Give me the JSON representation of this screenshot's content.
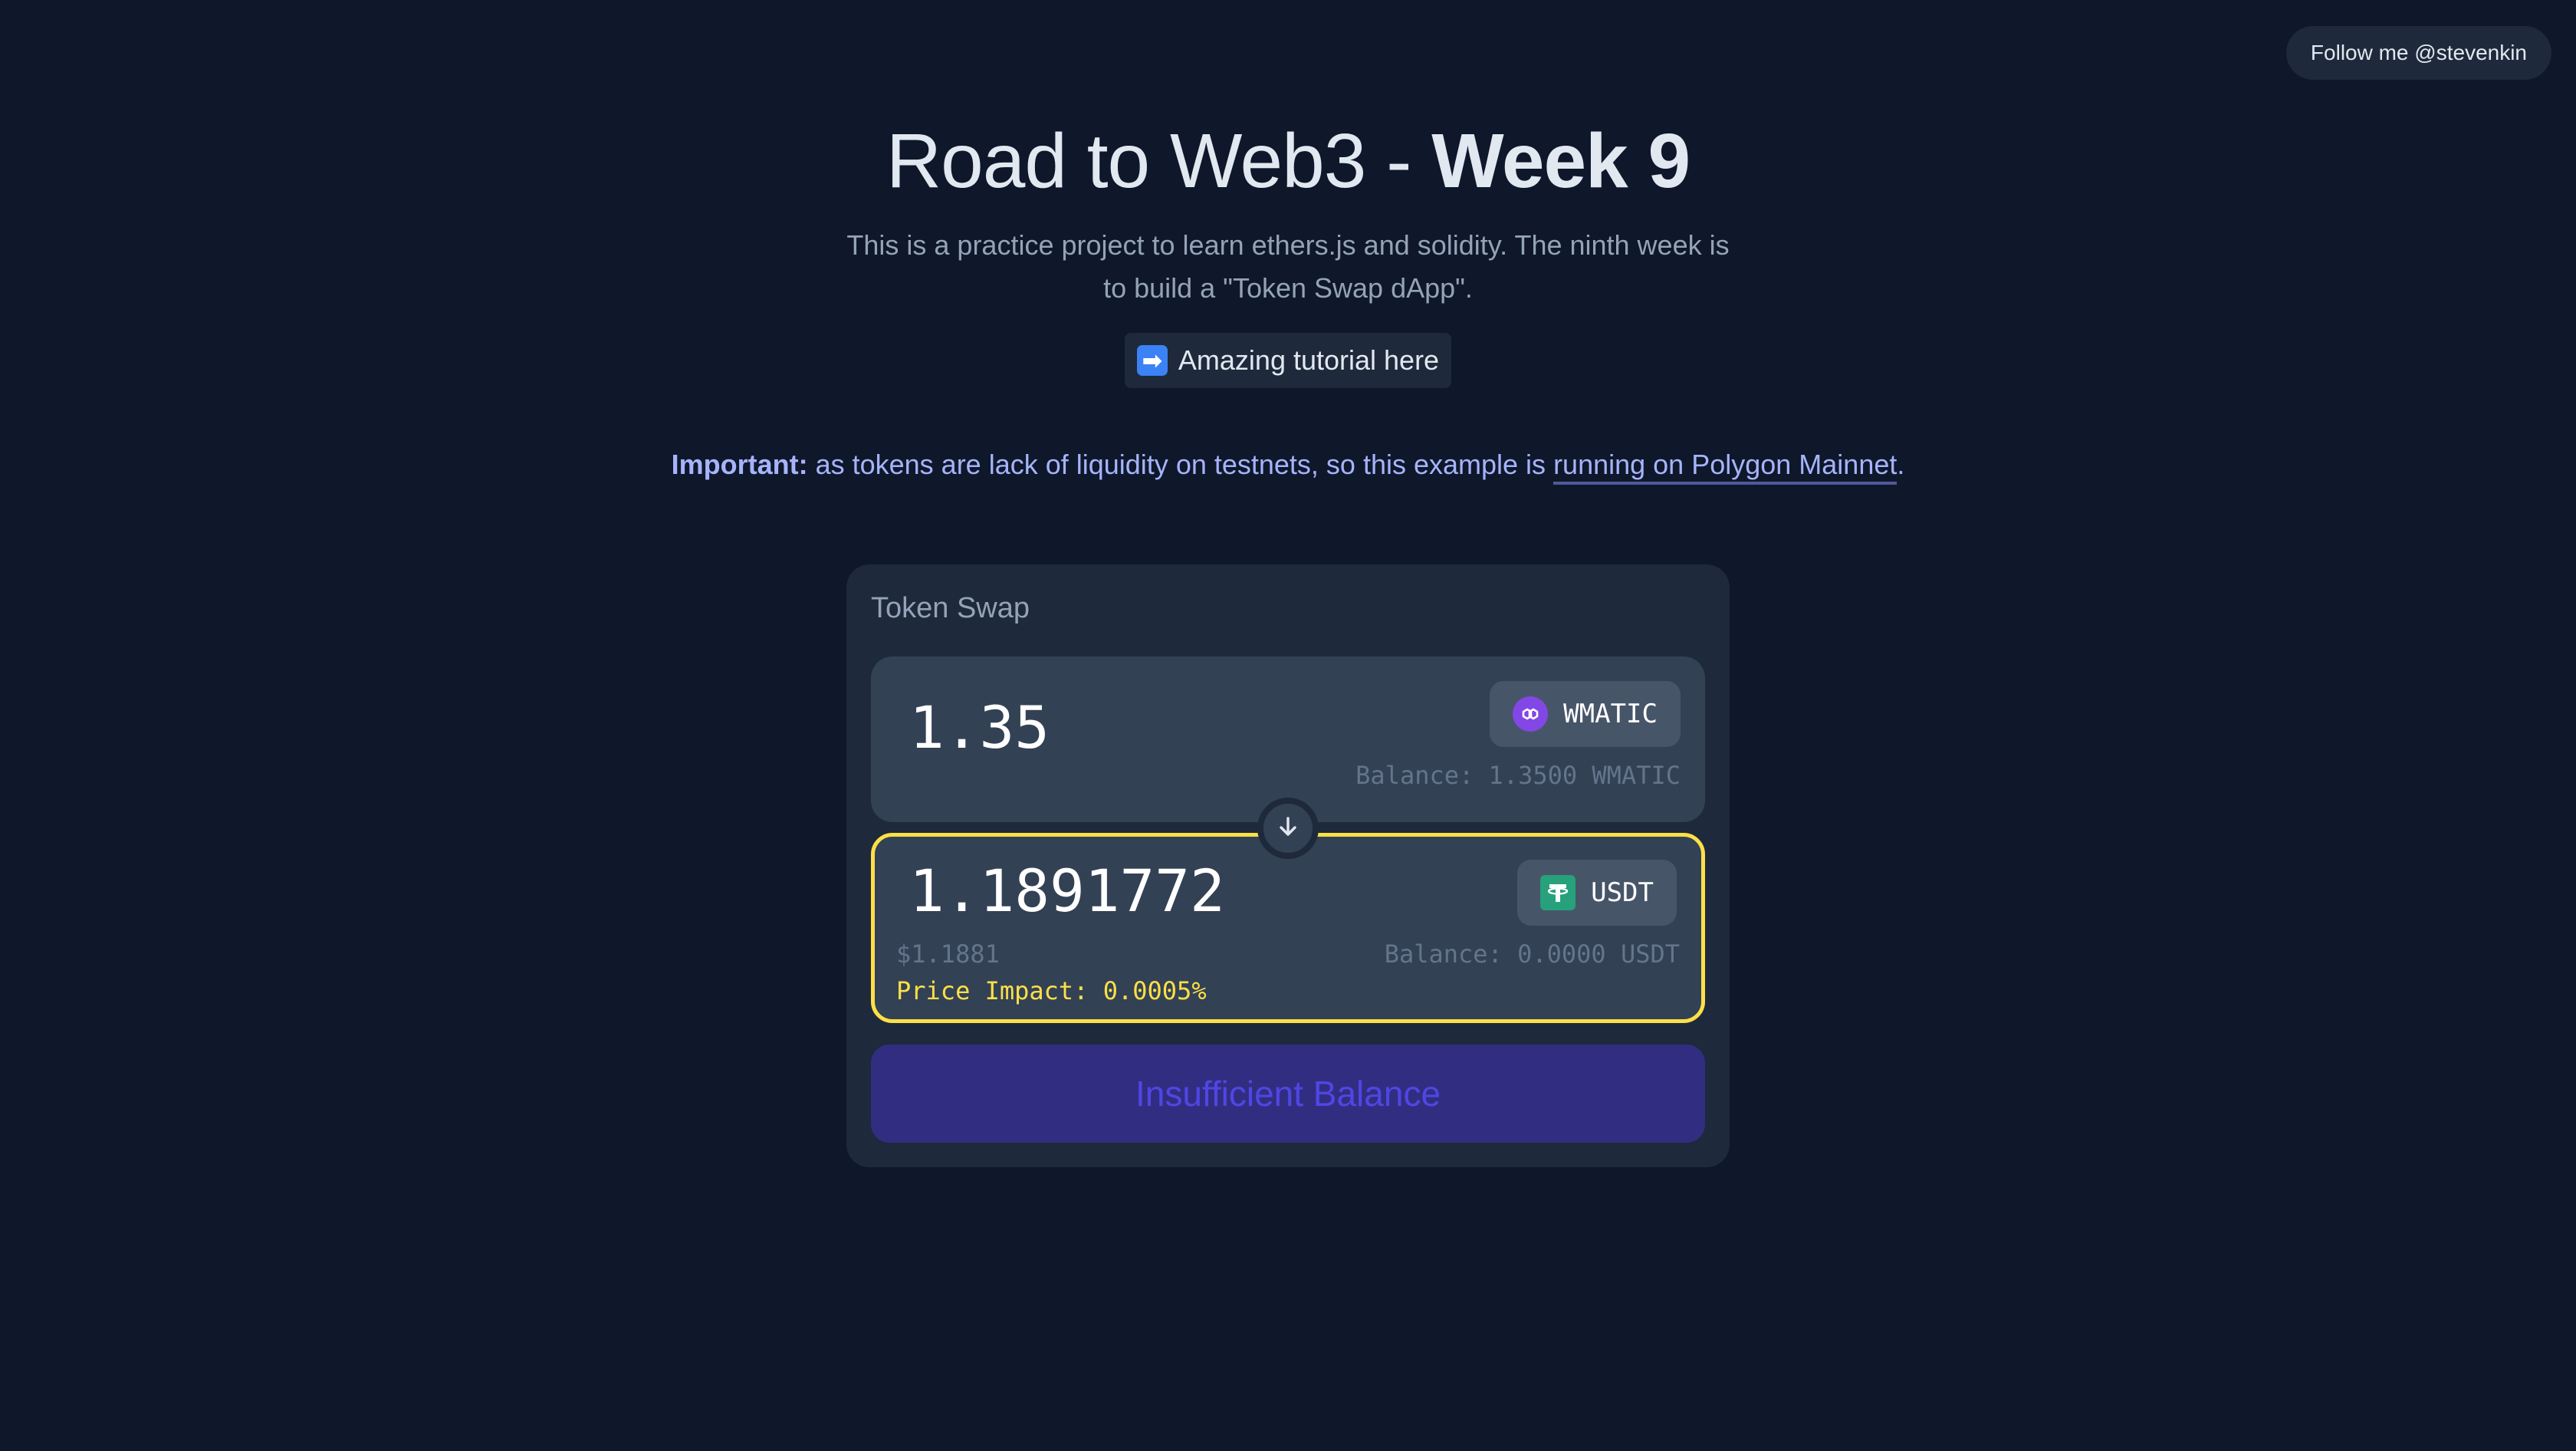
{
  "follow": {
    "label": "Follow me @stevenkin"
  },
  "header": {
    "title_main": "Road to Web3 - ",
    "title_bold": "Week 9",
    "subtitle": "This is a practice project to learn ethers.js and solidity. The ninth week is to build a \"Token Swap dApp\".",
    "tutorial_arrow": "➡",
    "tutorial_label": "Amazing tutorial here"
  },
  "notice": {
    "strong": "Important:",
    "text": " as tokens are lack of liquidity on testnets, so this example is ",
    "link": "running on Polygon Mainnet",
    "end": "."
  },
  "swap": {
    "title": "Token Swap",
    "from": {
      "amount": "1.35",
      "token": "WMATIC",
      "token_icon": "polygon-matic-icon",
      "balance": "Balance: 1.3500 WMATIC"
    },
    "to": {
      "amount": "1.1891772",
      "token": "USDT",
      "token_icon": "tether-usdt-icon",
      "usd_value": "$1.1881",
      "balance": "Balance: 0.0000 USDT",
      "price_impact": "Price Impact: 0.0005%"
    },
    "direction_icon": "arrow-down-icon",
    "action_label": "Insufficient Balance"
  },
  "colors": {
    "background": "#0f172a",
    "card": "#1e293b",
    "panel": "#334155",
    "highlight_border": "#fde047",
    "price_impact": "#fde047",
    "action_bg": "#312e81",
    "action_text": "#4f46e5",
    "notice": "#a5b4fc",
    "matic": "#8247e5",
    "usdt": "#26a17b"
  }
}
